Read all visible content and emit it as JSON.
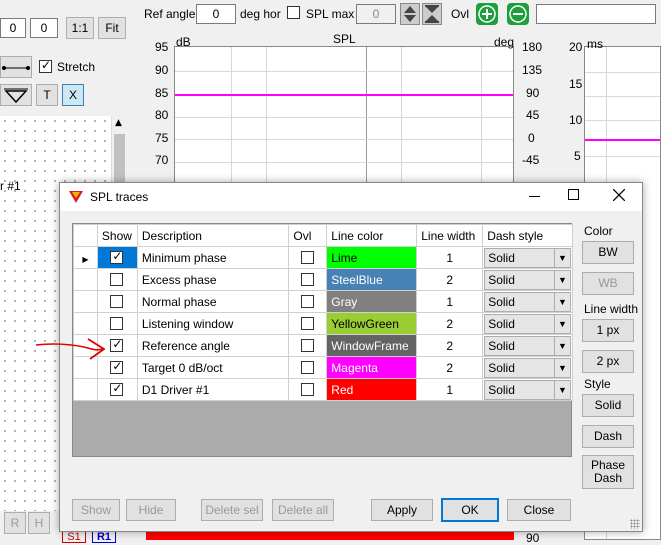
{
  "toolbar": {
    "field_a": "0",
    "field_b": "0",
    "ratio_btn": "1:1",
    "fit_btn": "Fit",
    "ref_angle_label": "Ref angle",
    "ref_angle_value": "0",
    "deg_hor_label": "deg hor",
    "spl_max_label": "SPL max",
    "spl_max_value": "0",
    "ovl_label": "Ovl",
    "stretch_label": "Stretch",
    "t_btn": "T",
    "x_btn": "X"
  },
  "left_panel": {
    "partial_text": "r #1",
    "r_btn": "R",
    "h_btn": "H",
    "s1_label": "S1",
    "r1_label": "R1"
  },
  "spl_plot": {
    "title": "SPL",
    "left_unit": "dB",
    "right_unit": "deg",
    "left_ticks": [
      "95",
      "90",
      "85",
      "80",
      "75",
      "70"
    ],
    "right_ticks": [
      "180",
      "135",
      "90",
      "45",
      "0",
      "-45"
    ],
    "right_tick_bottom": "90",
    "trace_color": "#ff00ff",
    "trace_level_db": 85
  },
  "ms_plot": {
    "unit": "ms",
    "ticks": [
      "20",
      "15",
      "10",
      "5"
    ],
    "trace_color": "#ff00ff",
    "trace_level_ms": 7.5
  },
  "dialog": {
    "title": "SPL traces",
    "columns": [
      "Show",
      "Description",
      "Ovl",
      "Line color",
      "Line width",
      "Dash style"
    ],
    "rows": [
      {
        "show": true,
        "description": "Minimum phase",
        "ovl": false,
        "color_name": "Lime",
        "color": "#00ff00",
        "text_color": "#000000",
        "width": "1",
        "dash": "Solid",
        "current": true
      },
      {
        "show": false,
        "description": "Excess phase",
        "ovl": false,
        "color_name": "SteelBlue",
        "color": "#4682b4",
        "text_color": "#ffffff",
        "width": "2",
        "dash": "Solid",
        "current": false
      },
      {
        "show": false,
        "description": "Normal phase",
        "ovl": false,
        "color_name": "Gray",
        "color": "#808080",
        "text_color": "#ffffff",
        "width": "1",
        "dash": "Solid",
        "current": false
      },
      {
        "show": false,
        "description": "Listening window",
        "ovl": false,
        "color_name": "YellowGreen",
        "color": "#9acd32",
        "text_color": "#000000",
        "width": "2",
        "dash": "Solid",
        "current": false
      },
      {
        "show": true,
        "description": "Reference angle",
        "ovl": false,
        "color_name": "WindowFrame",
        "color": "#646464",
        "text_color": "#ffffff",
        "width": "2",
        "dash": "Solid",
        "current": false
      },
      {
        "show": true,
        "description": "Target 0 dB/oct",
        "ovl": false,
        "color_name": "Magenta",
        "color": "#ff00ff",
        "text_color": "#ffffff",
        "width": "2",
        "dash": "Solid",
        "current": false
      },
      {
        "show": true,
        "description": "D1 Driver #1",
        "ovl": false,
        "color_name": "Red",
        "color": "#ff0000",
        "text_color": "#ffffff",
        "width": "1",
        "dash": "Solid",
        "current": false
      }
    ],
    "right_panel": {
      "color_label": "Color",
      "bw_btn": "BW",
      "wb_btn": "WB",
      "line_width_label": "Line width",
      "px1_btn": "1 px",
      "px2_btn": "2 px",
      "style_label": "Style",
      "solid_btn": "Solid",
      "dash_btn": "Dash",
      "phase_dash_line1": "Phase",
      "phase_dash_line2": "Dash"
    },
    "bottom_buttons": {
      "show": "Show",
      "hide": "Hide",
      "delete_sel": "Delete sel",
      "delete_all": "Delete all",
      "apply": "Apply",
      "ok": "OK",
      "close": "Close"
    }
  },
  "annotation_color": "#e00000"
}
